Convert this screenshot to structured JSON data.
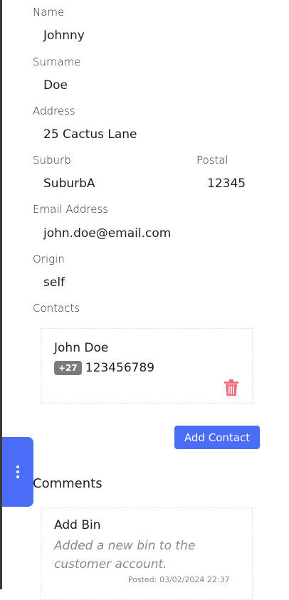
{
  "fields": {
    "name_label": "Name",
    "name_value": "Johnny",
    "surname_label": "Surname",
    "surname_value": "Doe",
    "address_label": "Address",
    "address_value": "25 Cactus Lane",
    "suburb_label": "Suburb",
    "suburb_value": "SuburbA",
    "postal_label": "Postal",
    "postal_value": "12345",
    "email_label": "Email Address",
    "email_value": "john.doe@email.com",
    "origin_label": "Origin",
    "origin_value": "self",
    "contacts_label": "Contacts"
  },
  "contact": {
    "name": "John Doe",
    "country_code": "+27",
    "phone": "123456789"
  },
  "actions": {
    "add_contact_label": "Add Contact"
  },
  "comments": {
    "heading": "Comments",
    "items": [
      {
        "title": "Add Bin",
        "body": "Added a new bin to the customer account.",
        "posted": "Posted: 03/02/2024 22:37"
      }
    ]
  },
  "colors": {
    "accent": "#4a6cf7",
    "delete": "#f06b7a",
    "badge": "#7b7b7b"
  },
  "icons": {
    "delete": "trash-icon",
    "menu": "vertical-dots-icon"
  }
}
